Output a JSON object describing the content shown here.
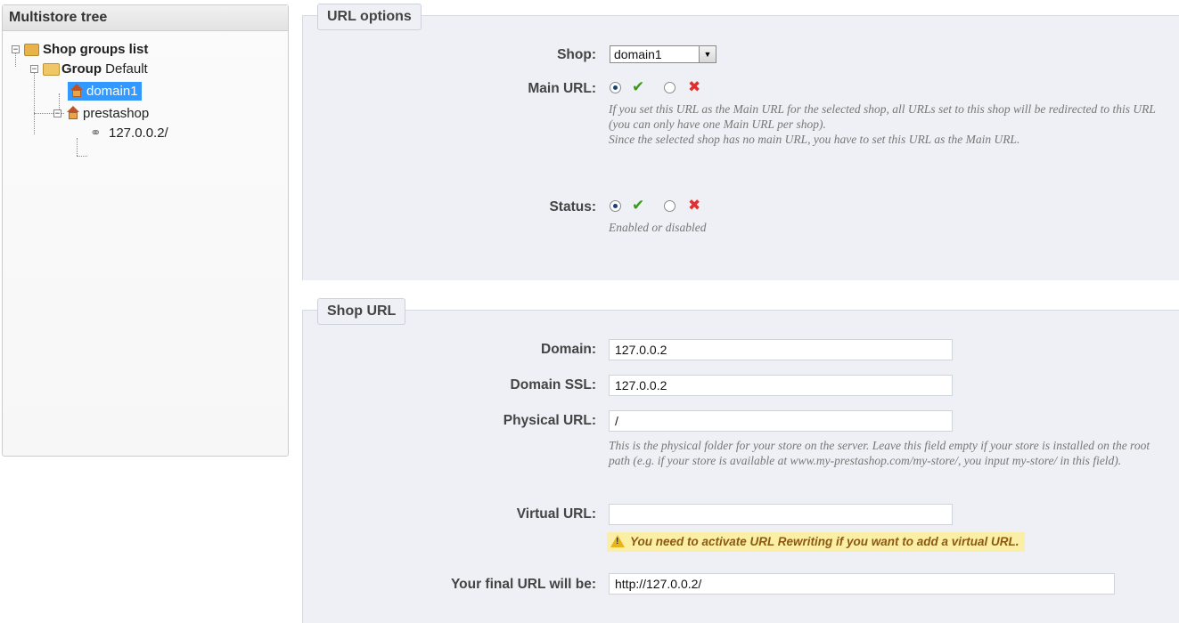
{
  "tree": {
    "title": "Multistore tree",
    "root_label": "Shop groups list",
    "group_prefix": "Group",
    "group_name": "Default",
    "shop_selected": "domain1",
    "shop_other": "prestashop",
    "url_item": "127.0.0.2/"
  },
  "url_options": {
    "legend": "URL options",
    "shop_label": "Shop:",
    "shop_value": "domain1",
    "main_url_label": "Main URL:",
    "main_url_help_1": "If you set this URL as the Main URL for the selected shop, all URLs set to this shop will be redirected to this URL (you can only have one Main URL per shop).",
    "main_url_help_2": "Since the selected shop has no main URL, you have to set this URL as the Main URL.",
    "status_label": "Status:",
    "status_help": "Enabled or disabled"
  },
  "shop_url": {
    "legend": "Shop URL",
    "domain_label": "Domain:",
    "domain_value": "127.0.0.2",
    "domain_ssl_label": "Domain SSL:",
    "domain_ssl_value": "127.0.0.2",
    "physical_label": "Physical URL:",
    "physical_value": "/",
    "physical_help": "This is the physical folder for your store on the server. Leave this field empty if your store is installed on the root path (e.g. if your store is available at www.my-prestashop.com/my-store/, you input my-store/ in this field).",
    "virtual_label": "Virtual URL:",
    "virtual_value": "",
    "virtual_warning": "You need to activate URL Rewriting if you want to add a virtual URL.",
    "final_label": "Your final URL will be:",
    "final_value": "http://127.0.0.2/"
  },
  "icons": {
    "yes": "check-icon",
    "no": "cross-icon",
    "warning": "warning-icon"
  },
  "colors": {
    "selection": "#3399ff",
    "check": "#3a9a1a",
    "cross": "#e03030",
    "warning_bg": "#fbefa8"
  }
}
